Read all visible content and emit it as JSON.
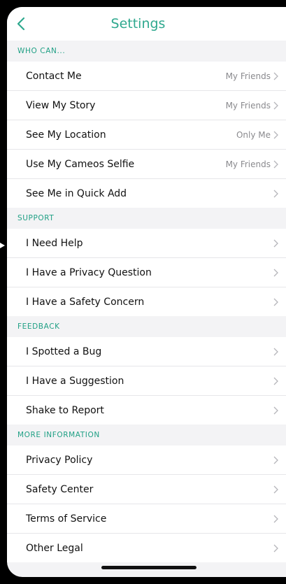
{
  "header": {
    "title": "Settings"
  },
  "colors": {
    "accent": "#2ea88e",
    "section": "#20a085",
    "background": "#f3f3f5"
  },
  "sections": [
    {
      "header": "WHO CAN...",
      "items": [
        {
          "label": "Contact Me",
          "value": "My Friends"
        },
        {
          "label": "View My Story",
          "value": "My Friends"
        },
        {
          "label": "See My Location",
          "value": "Only Me"
        },
        {
          "label": "Use My Cameos Selfie",
          "value": "My Friends"
        },
        {
          "label": "See Me in Quick Add",
          "value": ""
        }
      ]
    },
    {
      "header": "SUPPORT",
      "items": [
        {
          "label": "I Need Help",
          "value": ""
        },
        {
          "label": "I Have a Privacy Question",
          "value": ""
        },
        {
          "label": "I Have a Safety Concern",
          "value": ""
        }
      ]
    },
    {
      "header": "FEEDBACK",
      "items": [
        {
          "label": "I Spotted a Bug",
          "value": ""
        },
        {
          "label": "I Have a Suggestion",
          "value": ""
        },
        {
          "label": "Shake to Report",
          "value": ""
        }
      ]
    },
    {
      "header": "MORE INFORMATION",
      "items": [
        {
          "label": "Privacy Policy",
          "value": ""
        },
        {
          "label": "Safety Center",
          "value": ""
        },
        {
          "label": "Terms of Service",
          "value": ""
        },
        {
          "label": "Other Legal",
          "value": ""
        }
      ]
    }
  ]
}
